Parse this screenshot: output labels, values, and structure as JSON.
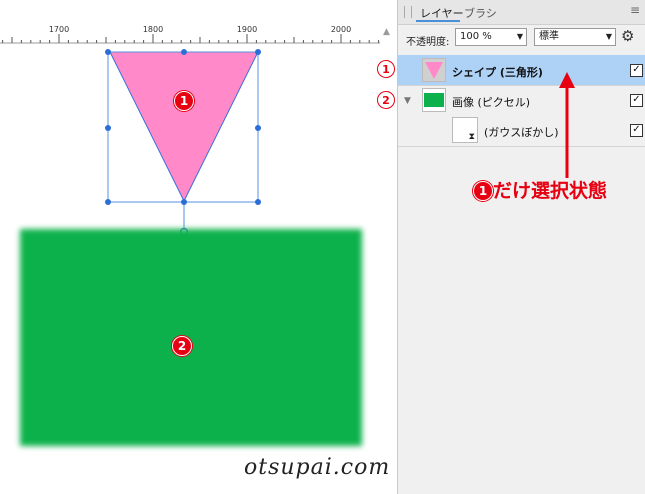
{
  "ruler": {
    "ticks": [
      "1700",
      "1800",
      "1900",
      "2000"
    ]
  },
  "canvas": {
    "shape_badge": "1",
    "pixel_badge": "2",
    "triangle_color": "#ff89c9",
    "rect_color": "#0db14b",
    "watermark": "otsupai.com"
  },
  "panel": {
    "tabs": {
      "layer": "レイヤー",
      "brush": "ブラシ"
    },
    "opacity_label": "不透明度:",
    "opacity_value": "100 %",
    "blend_mode": "標準",
    "layers": [
      {
        "name": "シェイプ (三角形)",
        "visible": true,
        "selected": true
      },
      {
        "name": "画像 (ピクセル)",
        "visible": true,
        "selected": false
      },
      {
        "name": "(ガウスぼかし)",
        "visible": true,
        "selected": false
      }
    ]
  },
  "annotation": {
    "row1_badge": "1",
    "row2_badge": "2",
    "callout_badge": "1",
    "callout_text": "だけ選択状態",
    "color": "#e60012"
  }
}
